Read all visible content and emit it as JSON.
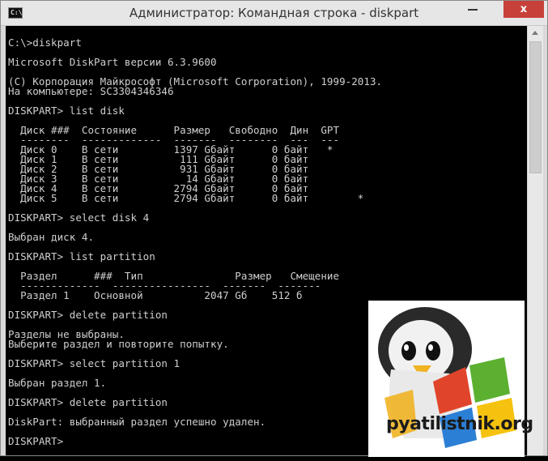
{
  "window": {
    "title": "Администратор: Командная строка - diskpart",
    "icon_text": "C:\\",
    "close_label": "x"
  },
  "console": {
    "lines": [
      "C:\\>diskpart",
      "",
      "Microsoft DiskPart версии 6.3.9600",
      "",
      "(C) Корпорация Майкрософт (Microsoft Corporation), 1999-2013.",
      "На компьютере: SC3304346346",
      "",
      "DISKPART> list disk",
      "",
      "  Диск ###  Состояние      Размер   Свободно  Дин  GPT",
      "  --------  -------------  -------  --------  ---  ---",
      "  Диск 0    В сети         1397 Gбайт      0 байт   *",
      "  Диск 1    В сети          111 Gбайт      0 байт",
      "  Диск 2    В сети          931 Gбайт      0 байт",
      "  Диск 3    В сети           14 Gбайт      0 байт",
      "  Диск 4    В сети         2794 Gбайт      0 байт",
      "  Диск 5    В сети         2794 Gбайт      0 байт        *",
      "",
      "DISKPART> select disk 4",
      "",
      "Выбран диск 4.",
      "",
      "DISKPART> list partition",
      "",
      "  Раздел      ###  Тип               Размер   Смещение",
      "  -------------  ----------------  -------  -------",
      "  Раздел 1    Основной          2047 Gб    512 б",
      "",
      "DISKPART> delete partition",
      "",
      "Разделы не выбраны.",
      "Выберите раздел и повторите попытку.",
      "",
      "DISKPART> select partition 1",
      "",
      "Выбран раздел 1.",
      "",
      "DISKPART> delete partition",
      "",
      "DiskPart: выбранный раздел успешно удален.",
      "",
      "DISKPART>"
    ]
  },
  "logo": {
    "text": "pyatilistnik.org"
  }
}
